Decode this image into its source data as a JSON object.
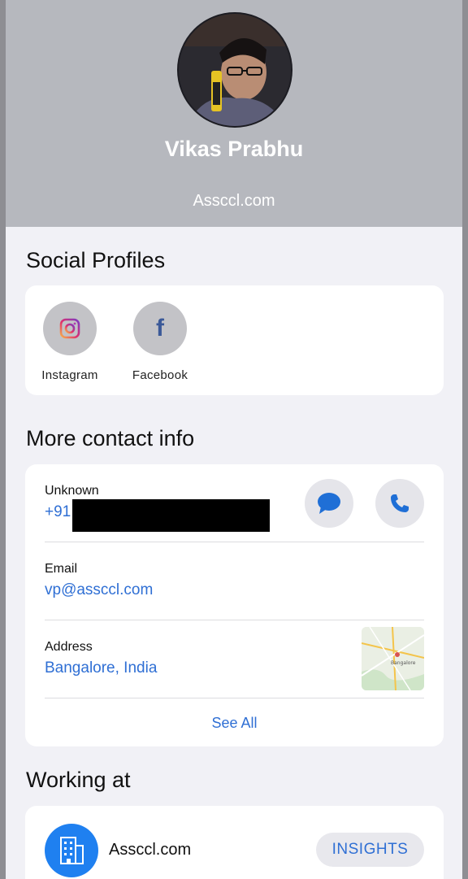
{
  "profile": {
    "name": "Vikas Prabhu",
    "company": "Assccl.com"
  },
  "social": {
    "title": "Social Profiles",
    "items": [
      {
        "label": "Instagram",
        "icon": "instagram-icon"
      },
      {
        "label": "Facebook",
        "icon": "facebook-icon"
      }
    ]
  },
  "contact": {
    "title": "More contact info",
    "phone": {
      "label": "Unknown",
      "value": "+91"
    },
    "email": {
      "label": "Email",
      "value": "vp@assccl.com"
    },
    "address": {
      "label": "Address",
      "value": "Bangalore, India",
      "map_city": "Bangalore"
    },
    "see_all": "See All"
  },
  "work": {
    "title": "Working at",
    "company": "Assccl.com",
    "insights_label": "INSIGHTS"
  },
  "colors": {
    "accent": "#2f6fd4",
    "header_bg": "#b6b8be",
    "work_icon_bg": "#1f80f0"
  }
}
